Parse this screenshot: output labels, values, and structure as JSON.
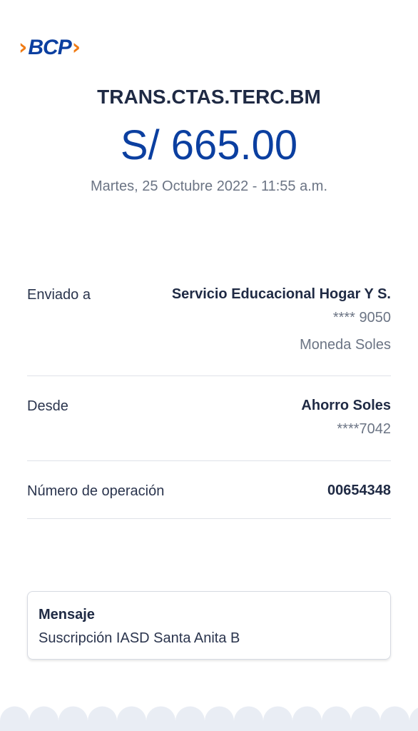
{
  "brand": {
    "logo_text": "BCP",
    "color_blue": "#0b3fa0",
    "color_orange": "#f07b14"
  },
  "header": {
    "title": "TRANS.CTAS.TERC.BM",
    "amount": "S/ 665.00",
    "date": "Martes, 25 Octubre 2022 - 11:55 a.m."
  },
  "details": {
    "sent_to": {
      "label": "Enviado a",
      "name": "Servicio Educacional Hogar Y S.",
      "account": "**** 9050",
      "currency": "Moneda Soles"
    },
    "from": {
      "label": "Desde",
      "account_name": "Ahorro Soles",
      "account": "****7042"
    },
    "operation": {
      "label": "Número de operación",
      "number": "00654348"
    }
  },
  "message": {
    "title": "Mensaje",
    "body": "Suscripción IASD Santa Anita B"
  }
}
